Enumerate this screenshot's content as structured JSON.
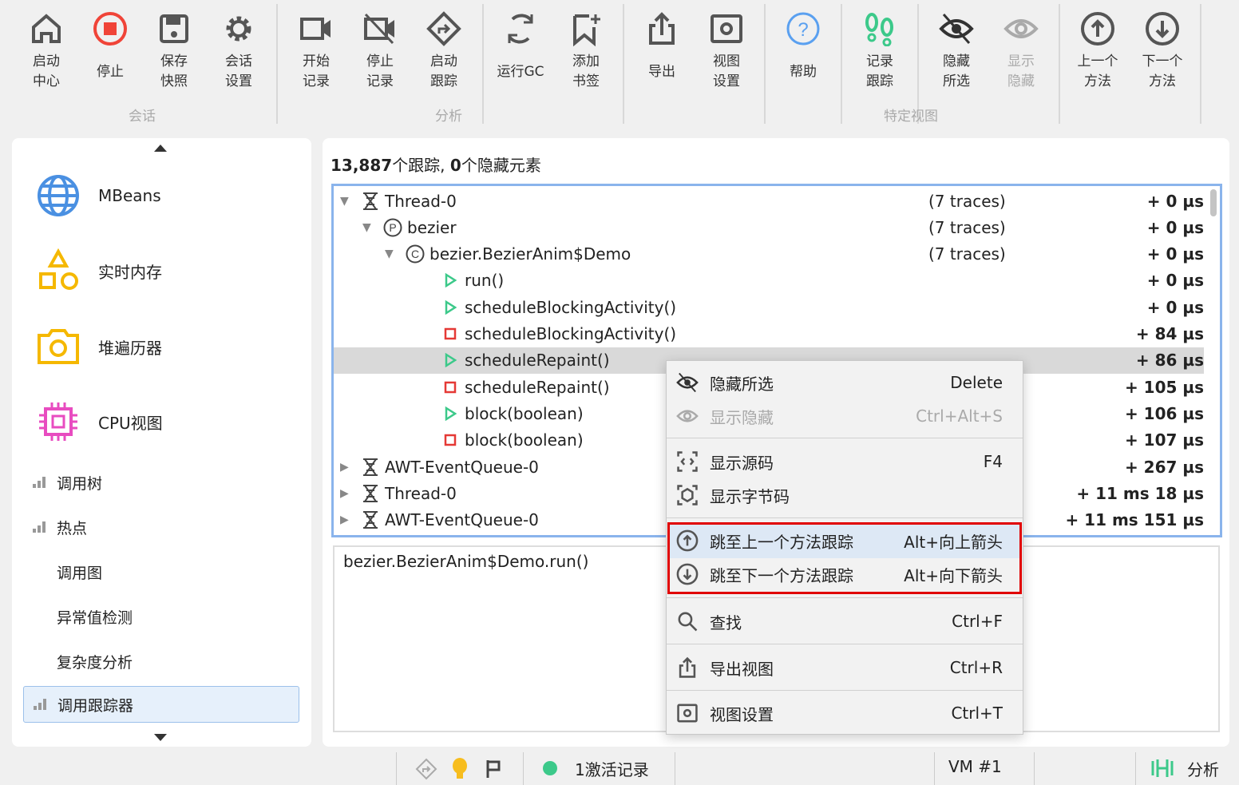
{
  "toolbar": {
    "buttons": [
      {
        "label": "启动\n中心",
        "icon": "home-icon"
      },
      {
        "label": "停止",
        "icon": "stop-icon"
      },
      {
        "label": "保存\n快照",
        "icon": "save-icon"
      },
      {
        "label": "会话\n设置",
        "icon": "gear-icon"
      },
      {
        "label": "开始\n记录",
        "icon": "video-icon"
      },
      {
        "label": "停止\n记录",
        "icon": "video-off-icon"
      },
      {
        "label": "启动\n跟踪",
        "icon": "route-icon"
      },
      {
        "label": "运行GC",
        "icon": "refresh-icon"
      },
      {
        "label": "添加\n书签",
        "icon": "bookmark-add-icon"
      },
      {
        "label": "导出",
        "icon": "export-icon"
      },
      {
        "label": "视图\n设置",
        "icon": "view-settings-icon"
      },
      {
        "label": "帮助",
        "icon": "help-icon"
      },
      {
        "label": "记录\n跟踪",
        "icon": "footsteps-icon"
      },
      {
        "label": "隐藏\n所选",
        "icon": "eye-off-icon"
      },
      {
        "label": "显示\n隐藏",
        "icon": "eye-icon"
      },
      {
        "label": "上一个\n方法",
        "icon": "arrow-up-circle-icon"
      },
      {
        "label": "下一个\n方法",
        "icon": "arrow-down-circle-icon"
      }
    ],
    "groups": [
      "会话",
      "分析",
      "特定视图"
    ]
  },
  "sidebar": {
    "big": [
      "MBeans",
      "实时内存",
      "堆遍历器",
      "CPU视图"
    ],
    "small": [
      "调用树",
      "热点",
      "调用图",
      "异常值检测",
      "复杂度分析",
      "调用跟踪器"
    ]
  },
  "main": {
    "summary_count": "13,887",
    "summary_text1": "个跟踪, ",
    "summary_hidden": "0",
    "summary_text2": "个隐藏元素",
    "rows": [
      {
        "level": 0,
        "exp": "down",
        "icon": "thread",
        "name": "Thread-0",
        "traces": "(7 traces)",
        "time": "+ 0 µs"
      },
      {
        "level": 1,
        "exp": "down",
        "icon": "package",
        "name": "bezier",
        "traces": "(7 traces)",
        "time": "+ 0 µs"
      },
      {
        "level": 2,
        "exp": "down",
        "icon": "class",
        "name": "bezier.BezierAnim$Demo",
        "traces": "(7 traces)",
        "time": "+ 0 µs"
      },
      {
        "level": 3,
        "icon": "enter",
        "name": "run()",
        "time": "+ 0 µs"
      },
      {
        "level": 3,
        "icon": "enter",
        "name": "scheduleBlockingActivity()",
        "time": "+ 0 µs"
      },
      {
        "level": 3,
        "icon": "exit",
        "name": "scheduleBlockingActivity()",
        "time": "+ 84 µs"
      },
      {
        "level": 3,
        "icon": "enter",
        "name": "scheduleRepaint()",
        "time": "+ 86 µs",
        "selected": true
      },
      {
        "level": 3,
        "icon": "exit",
        "name": "scheduleRepaint()",
        "time": "+ 105 µs"
      },
      {
        "level": 3,
        "icon": "enter",
        "name": "block(boolean)",
        "time": "+ 106 µs"
      },
      {
        "level": 3,
        "icon": "exit",
        "name": "block(boolean)",
        "time": "+ 107 µs"
      },
      {
        "level": 0,
        "exp": "right",
        "icon": "thread",
        "name": "AWT-EventQueue-0",
        "time": "+ 267 µs"
      },
      {
        "level": 0,
        "exp": "right",
        "icon": "thread",
        "name": "Thread-0",
        "time": "+ 11 ms 18 µs"
      },
      {
        "level": 0,
        "exp": "right",
        "icon": "thread",
        "name": "AWT-EventQueue-0",
        "time": "+ 11 ms 151 µs"
      }
    ],
    "detail": "bezier.BezierAnim$Demo.run()"
  },
  "menu": [
    {
      "label": "隐藏所选",
      "shortcut": "Delete",
      "icon": "eye-off-icon"
    },
    {
      "label": "显示隐藏",
      "shortcut": "Ctrl+Alt+S",
      "icon": "eye-icon",
      "disabled": true
    },
    {
      "label": "显示源码",
      "shortcut": "F4",
      "icon": "source-icon"
    },
    {
      "label": "显示字节码",
      "shortcut": "",
      "icon": "bytecode-icon"
    },
    {
      "label": "跳至上一个方法跟踪",
      "shortcut": "Alt+向上箭头",
      "icon": "arrow-up-circle-icon"
    },
    {
      "label": "跳至下一个方法跟踪",
      "shortcut": "Alt+向下箭头",
      "icon": "arrow-down-circle-icon"
    },
    {
      "label": "查找",
      "shortcut": "Ctrl+F",
      "icon": "search-icon"
    },
    {
      "label": "导出视图",
      "shortcut": "Ctrl+R",
      "icon": "export-icon"
    },
    {
      "label": "视图设置",
      "shortcut": "Ctrl+T",
      "icon": "view-settings-icon"
    }
  ],
  "status": {
    "recording": "1激活记录",
    "vm": "VM #1",
    "mode": "分析"
  },
  "colors": {
    "accent": "#4a90e2",
    "green": "#3cc98a",
    "red": "#e53935",
    "highlight": "#e00000"
  }
}
